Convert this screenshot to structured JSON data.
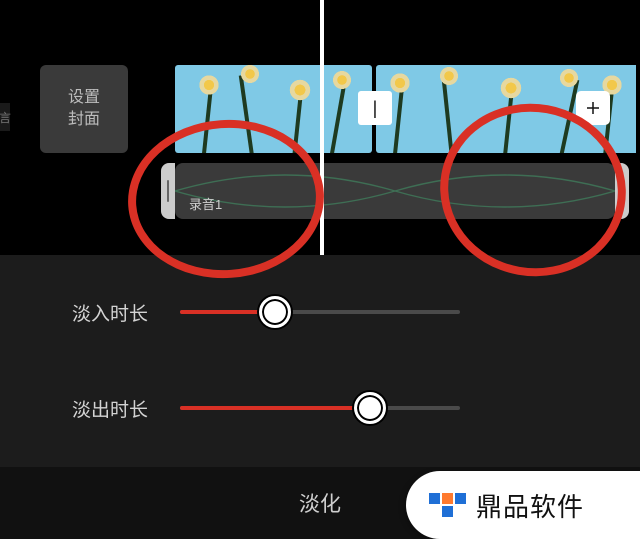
{
  "cover_button": {
    "line1": "设置",
    "line2": "封面"
  },
  "edge_tag": "言",
  "audio": {
    "label": "录音1"
  },
  "sliders": {
    "fade_in": {
      "label": "淡入时长",
      "percent": 34
    },
    "fade_out": {
      "label": "淡出时长",
      "percent": 68
    }
  },
  "bottom_tab": {
    "label": "淡化"
  },
  "transition_icon": "|",
  "watermark": {
    "text": "鼎品软件",
    "brand_color": "#1f6fd6",
    "accent_color": "#ff7a2e"
  }
}
